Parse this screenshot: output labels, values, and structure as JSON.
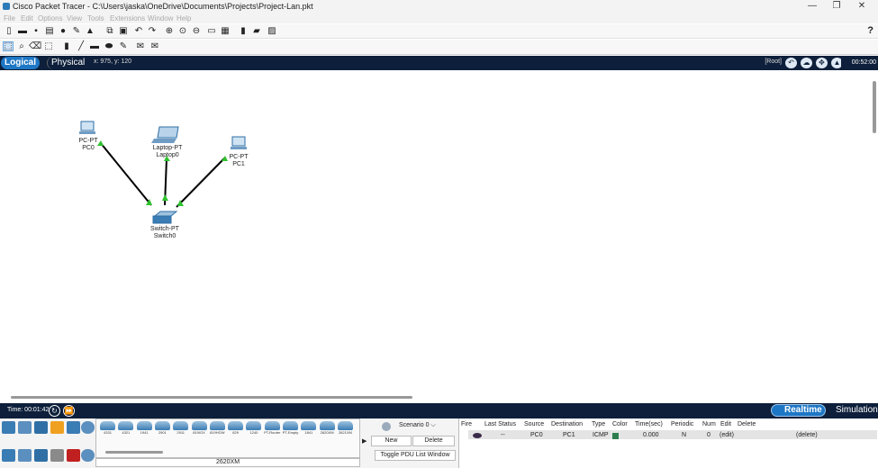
{
  "window": {
    "title": "Cisco Packet Tracer - C:\\Users\\jaska\\OneDrive\\Documents\\Projects\\Project-Lan.pkt",
    "minimize": "—",
    "restore": "❐",
    "close": "✕"
  },
  "menu": {
    "items": [
      "File",
      "Edit",
      "Options",
      "View",
      "Tools",
      "Extensions",
      "Window",
      "Help"
    ]
  },
  "toolbar": {
    "help_label": "?"
  },
  "modebar": {
    "logical_label": "Logical",
    "physical_label": "Physical",
    "coords": "x: 975, y: 120",
    "root_label": "[Root]",
    "clock": "00:52:00"
  },
  "devices": {
    "pc0": {
      "type": "PC-PT",
      "name": "PC0"
    },
    "laptop0": {
      "type": "Laptop-PT",
      "name": "Laptop0"
    },
    "pc1": {
      "type": "PC-PT",
      "name": "PC1"
    },
    "switch0": {
      "type": "Switch-PT",
      "name": "Switch0"
    }
  },
  "link_status_color": "#2ec22e",
  "status": {
    "time": "Time: 00:01:42",
    "realtime_label": "Realtime",
    "simulation_label": "Simulation"
  },
  "device_panel": {
    "models": [
      "4331",
      "4321",
      "1941",
      "2901",
      "2911",
      "819IOX",
      "819HGW",
      "829",
      "1240",
      "PT-Router",
      "PT-Empty",
      "1841",
      "2620XM",
      "2621XM"
    ],
    "selected_model": "2620XM"
  },
  "scenario": {
    "select_value": "Scenario 0",
    "new_label": "New",
    "delete_label": "Delete",
    "toggle_label": "Toggle PDU List Window"
  },
  "pdu_table": {
    "headers": [
      "Fire",
      "Last Status",
      "Source",
      "Destination",
      "Type",
      "Color",
      "Time(sec)",
      "Periodic",
      "Num",
      "Edit",
      "Delete"
    ],
    "rows": [
      {
        "last_status": "--",
        "source": "PC0",
        "destination": "PC1",
        "type": "ICMP",
        "color": "#2e7d4f",
        "time": "0.000",
        "periodic": "N",
        "num": "0",
        "edit": "(edit)",
        "delete": "(delete)"
      }
    ]
  }
}
